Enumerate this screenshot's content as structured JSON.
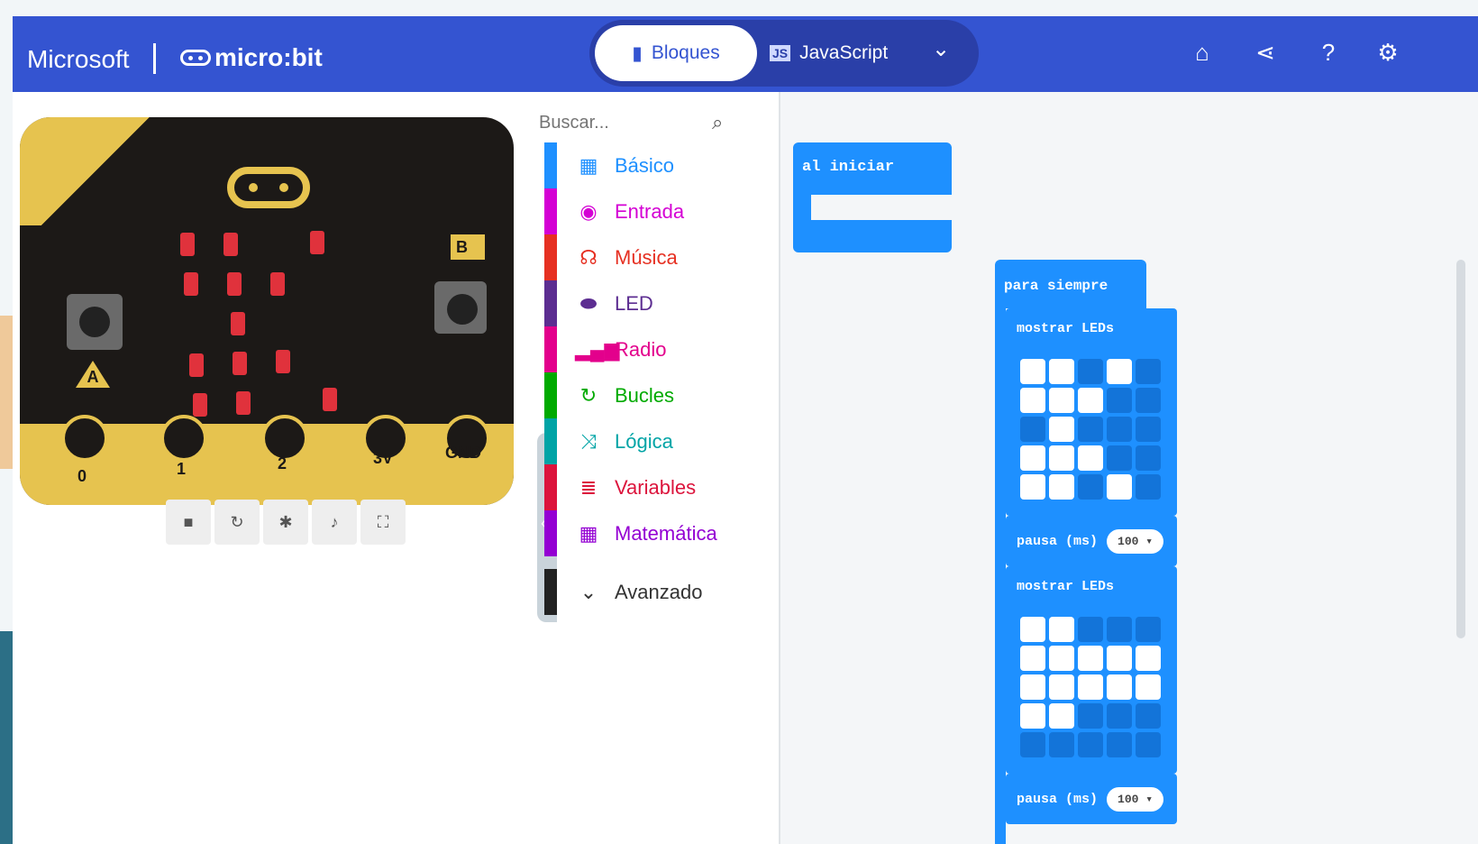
{
  "header": {
    "brand_microsoft": "Microsoft",
    "brand_microbit": "micro:bit",
    "tabs": {
      "blocks": "Bloques",
      "javascript": "JavaScript"
    },
    "icons": [
      "home-icon",
      "share-icon",
      "help-icon",
      "settings-icon"
    ]
  },
  "simulator": {
    "labels": {
      "a": "A",
      "b": "B"
    },
    "pins": [
      "0",
      "1",
      "2",
      "3V",
      "GND"
    ],
    "controls": [
      "stop-icon",
      "restart-icon",
      "debug-icon",
      "sound-icon",
      "fullscreen-icon"
    ]
  },
  "toolbox": {
    "search_placeholder": "Buscar...",
    "categories": [
      {
        "label": "Básico",
        "color": "#1e90ff",
        "icon": "grid-icon"
      },
      {
        "label": "Entrada",
        "color": "#d400d4",
        "icon": "target-icon"
      },
      {
        "label": "Música",
        "color": "#e63022",
        "icon": "headphones-icon"
      },
      {
        "label": "LED",
        "color": "#5c2d91",
        "icon": "toggle-icon"
      },
      {
        "label": "Radio",
        "color": "#e3008c",
        "icon": "signal-icon"
      },
      {
        "label": "Bucles",
        "color": "#00aa00",
        "icon": "loop-icon"
      },
      {
        "label": "Lógica",
        "color": "#00a4a6",
        "icon": "shuffle-icon"
      },
      {
        "label": "Variables",
        "color": "#dc143c",
        "icon": "lines-icon"
      },
      {
        "label": "Matemática",
        "color": "#9400d3",
        "icon": "calculator-icon"
      }
    ],
    "advanced": "Avanzado"
  },
  "workspace": {
    "on_start": "al iniciar",
    "forever": "para siempre",
    "show_leds": "mostrar LEDs",
    "pause": "pausa (ms)",
    "pause_value": "100",
    "colors": {
      "block": "#1e90ff"
    }
  }
}
